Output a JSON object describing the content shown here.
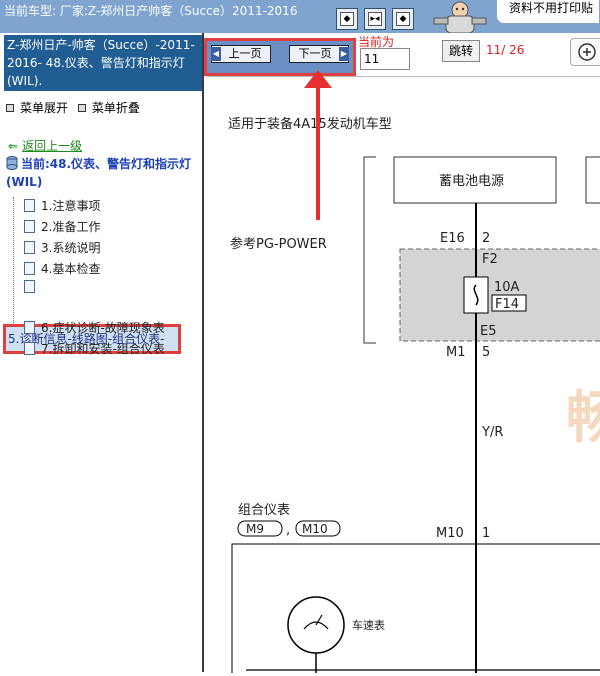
{
  "topbar": {
    "vehicle": "当前车型:  厂家:Z-郑州日产帅客（Succe）2011-2016",
    "notice": "资料不用打印贴"
  },
  "left": {
    "title": "Z-郑州日产-帅客（Succe）-2011-2016- 48.仪表、警告灯和指示灯(WIL).",
    "expand": "菜单展开",
    "collapse": "菜单折叠",
    "back": "返回上一级",
    "current": "当前:48.仪表、警告灯和指示灯(WIL)",
    "items": [
      "1.注意事项",
      "2.准备工作",
      "3.系统说明",
      "4.基本检查",
      "5.诊断信息-线路图-组合仪表-",
      "6.症状诊断-故障现象表",
      "7.拆卸和安装-组合仪表"
    ]
  },
  "toolbar": {
    "prev": "上一页",
    "next": "下一页",
    "current_label": "当前为",
    "page_value": "11",
    "jump": "跳转",
    "count": "11/ 26"
  },
  "diagram": {
    "applies": "适用于装备4A15发动机车型",
    "battery": "蓄电池电源",
    "ref": "参考PG-POWER",
    "pin_e16": "E16",
    "pin_e16_num": "2",
    "f2": "F2",
    "fuse_amp": "10A",
    "fuse_id": "F14",
    "e5": "E5",
    "m1": "M1",
    "m1_num": "5",
    "wire": "Y/R",
    "cluster": "组合仪表",
    "m9": "M9",
    "comma": ",",
    "m10": "M10",
    "m10_label": "M10",
    "m10_num": "1",
    "speedometer": "车速表",
    "watermark": "畅"
  }
}
